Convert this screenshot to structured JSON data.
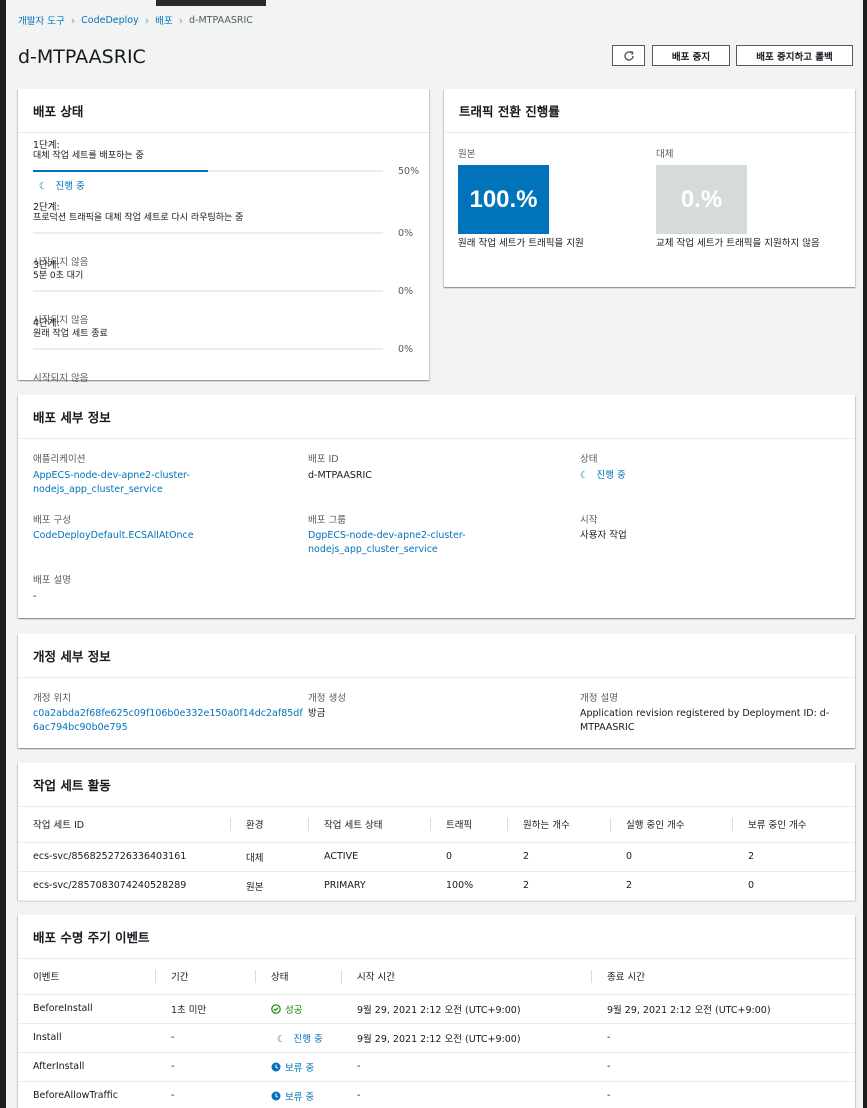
{
  "breadcrumb": [
    "개발자 도구",
    "CodeDeploy",
    "배포",
    "d-MTPAASRIC"
  ],
  "page_title": "d-MTPAASRIC",
  "buttons": {
    "refresh_icon": "refresh-icon",
    "stop": "배포 중지",
    "stop_rollback": "배포 중지하고 롤백"
  },
  "status_card": {
    "title": "배포 상태",
    "steps": [
      {
        "step": "1단계:",
        "desc": "대체 작업 세트를 배포하는 중",
        "percent": "50%",
        "progress": 0.5,
        "state": "진행 중",
        "in_progress": true
      },
      {
        "step": "2단계:",
        "desc": "프로덕션 트래픽을 대체 작업 세트로 다시 라우팅하는 중",
        "percent": "0%",
        "progress": 0,
        "state": "시작되지 않음"
      },
      {
        "step": "3단계:",
        "desc": "5분 0초 대기",
        "percent": "0%",
        "progress": 0,
        "state": "시작되지 않음"
      },
      {
        "step": "4단계:",
        "desc": "원래 작업 세트 종료",
        "percent": "0%",
        "progress": 0,
        "state": "시작되지 않음"
      }
    ]
  },
  "traffic_card": {
    "title": "트래픽 전환 진행률",
    "original": {
      "label": "원본",
      "value": "100.%",
      "desc": "원래 작업 세트가 트래픽을 지원",
      "color": "#0073bb"
    },
    "replacement": {
      "label": "대체",
      "value": "0.%",
      "desc": "교체 작업 세트가 트래픽을 지원하지 않음",
      "color": "#d5dbdb"
    }
  },
  "details_card": {
    "title": "배포 세부 정보",
    "application_label": "애플리케이션",
    "application": "AppECS-node-dev-apne2-cluster-nodejs_app_cluster_service",
    "deployment_id_label": "배포 ID",
    "deployment_id": "d-MTPAASRIC",
    "status_label": "상태",
    "status": "진행 중",
    "config_label": "배포 구성",
    "config": "CodeDeployDefault.ECSAllAtOnce",
    "group_label": "배포 그룹",
    "group": "DgpECS-node-dev-apne2-cluster-nodejs_app_cluster_service",
    "initiated_label": "시작",
    "initiated": "사용자 작업",
    "desc_label": "배포 설명",
    "desc": "-"
  },
  "revision_card": {
    "title": "개정 세부 정보",
    "location_label": "개정 위치",
    "location": "c0a2abda2f68fe625c09f106b0e332e150a0f14dc2af85df6ac794bc90b0e795",
    "created_label": "개정 생성",
    "created": "방금",
    "desc_label": "개정 설명",
    "desc": "Application revision registered by Deployment ID: d-MTPAASRIC"
  },
  "taskset_card": {
    "title": "작업 세트 활동",
    "columns": [
      "작업 세트 ID",
      "환경",
      "작업 세트 상태",
      "트래픽",
      "원하는 개수",
      "실행 중인 개수",
      "보류 중인 개수"
    ],
    "rows": [
      [
        "ecs-svc/8568252726336403161",
        "대체",
        "ACTIVE",
        "0",
        "2",
        "0",
        "2"
      ],
      [
        "ecs-svc/2857083074240528289",
        "원본",
        "PRIMARY",
        "100%",
        "2",
        "2",
        "0"
      ]
    ]
  },
  "lifecycle_card": {
    "title": "배포 수명 주기 이벤트",
    "columns": [
      "이벤트",
      "기간",
      "상태",
      "시작 시간",
      "종료 시간"
    ],
    "rows": [
      {
        "event": "BeforeInstall",
        "duration": "1초 미만",
        "status": "성공",
        "status_type": "success",
        "start": "9월 29, 2021 2:12 오전 (UTC+9:00)",
        "end": "9월 29, 2021 2:12 오전 (UTC+9:00)"
      },
      {
        "event": "Install",
        "duration": "-",
        "status": "진행 중",
        "status_type": "progress",
        "start": "9월 29, 2021 2:12 오전 (UTC+9:00)",
        "end": "-"
      },
      {
        "event": "AfterInstall",
        "duration": "-",
        "status": "보류 중",
        "status_type": "pending",
        "start": "-",
        "end": "-"
      },
      {
        "event": "BeforeAllowTraffic",
        "duration": "-",
        "status": "보류 중",
        "status_type": "pending",
        "start": "-",
        "end": "-"
      }
    ]
  }
}
